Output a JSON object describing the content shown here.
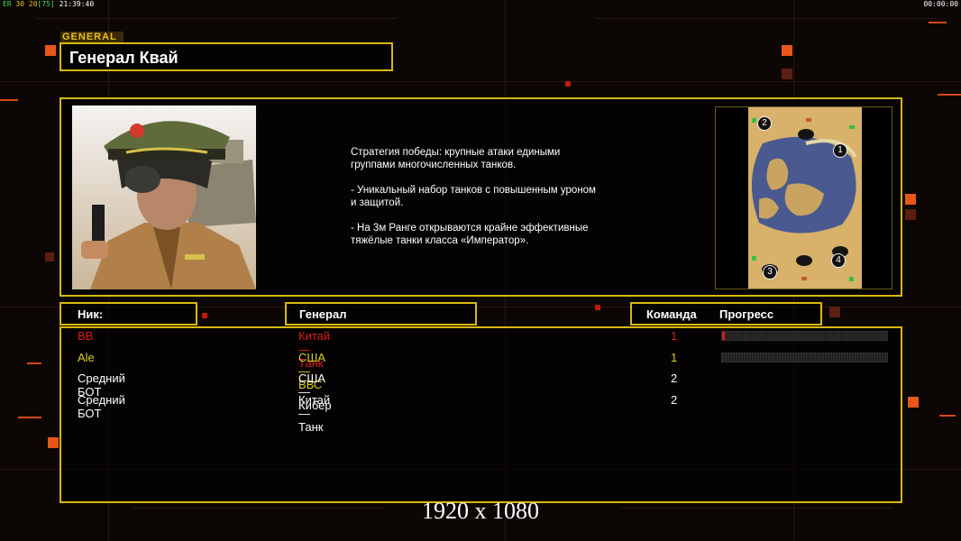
{
  "hud": {
    "left_parts": [
      "ER",
      " 30 ",
      "20",
      "[75]",
      " 21:39:40"
    ],
    "right": "00:00:00"
  },
  "header": {
    "tag": "GENERAL",
    "title": "Генерал Квай"
  },
  "info": {
    "strategy": "Стратегия победы: крупные атаки едиными\n группами многочисленных танков.\n\n- Уникальный набор танков с повышенным уроном\n и защитой.\n\n- На 3м Ранге открываются крайне эффективные\n тяжёлые танки класса «Император».",
    "map_slots": [
      "2",
      "1",
      "3",
      "4"
    ]
  },
  "columns": {
    "nick": "Ник:",
    "general": "Генерал",
    "team": "Команда",
    "progress": "Прогресс"
  },
  "players": [
    {
      "nick": "BB",
      "general": "Китай — Танк",
      "team": "1",
      "color": "#e01a1a",
      "progress": 0.01
    },
    {
      "nick": "Ale",
      "general": "США — ВВС",
      "team": "1",
      "color": "#d8d020",
      "progress": 0.0
    },
    {
      "nick": "Средний БОТ",
      "general": "США — Кибер",
      "team": "2",
      "color": "#ffffff",
      "progress": null
    },
    {
      "nick": "Средний БОТ",
      "general": "Китай — Танк",
      "team": "2",
      "color": "#ffffff",
      "progress": null
    }
  ],
  "resolution_label": "1920 x 1080",
  "colors": {
    "accent_gold": "#d9b80f",
    "accent_orange": "#e8561a"
  }
}
